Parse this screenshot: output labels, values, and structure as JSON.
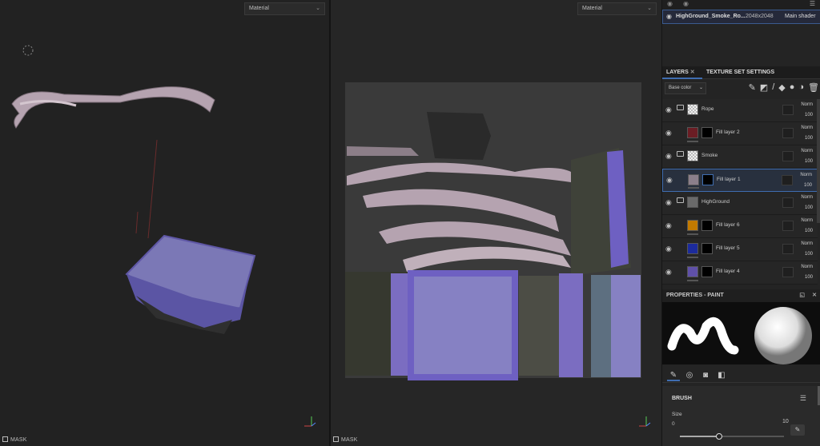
{
  "viewport3d": {
    "shader_select": "Material",
    "mask_label": "MASK"
  },
  "viewport2d": {
    "shader_select": "Material",
    "mask_label": "MASK"
  },
  "texture_set": {
    "name": "HighGround_Smoke_Ro...",
    "resolution": "2048x2048",
    "shader": "Main shader"
  },
  "tabs": {
    "layers": "LAYERS",
    "texture_set_settings": "TEXTURE SET SETTINGS"
  },
  "channel_select": "Base color",
  "layers": [
    {
      "name": "Rope",
      "type": "folder",
      "blend": "Norm",
      "opacity": "100"
    },
    {
      "name": "Fill layer 2",
      "type": "fill",
      "blend": "Norm",
      "opacity": "100"
    },
    {
      "name": "Smoke",
      "type": "folder",
      "blend": "Norm",
      "opacity": "100"
    },
    {
      "name": "Fill layer 1",
      "type": "fill",
      "blend": "Norm",
      "opacity": "100"
    },
    {
      "name": "HighGround",
      "type": "folder",
      "blend": "Norm",
      "opacity": "100"
    },
    {
      "name": "Fill layer 6",
      "type": "fill",
      "blend": "Norm",
      "opacity": "100"
    },
    {
      "name": "Fill layer 5",
      "type": "fill",
      "blend": "Norm",
      "opacity": "100"
    },
    {
      "name": "Fill layer 4",
      "type": "fill",
      "blend": "Norm",
      "opacity": "100"
    }
  ],
  "properties": {
    "title": "PROPERTIES - PAINT",
    "brush_label": "BRUSH",
    "size_label": "Size",
    "size_value": "10"
  },
  "colors": {
    "accent": "#3f6db0",
    "purple": "#6d5fb8",
    "rope": "#b8a7b2"
  }
}
